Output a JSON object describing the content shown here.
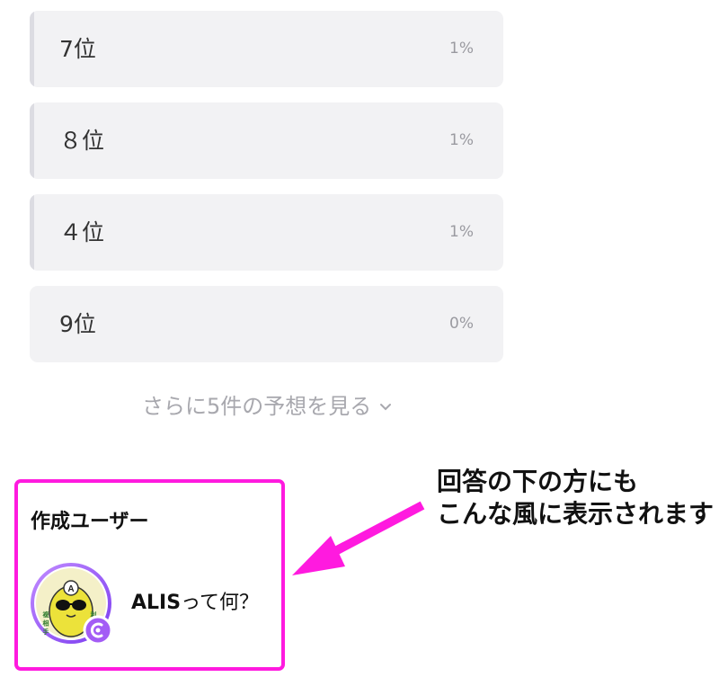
{
  "poll": {
    "options": [
      {
        "label": "7位",
        "percent_text": "1%",
        "percent": 1
      },
      {
        "label": "８位",
        "percent_text": "1%",
        "percent": 1
      },
      {
        "label": "４位",
        "percent_text": "1%",
        "percent": 1
      },
      {
        "label": "9位",
        "percent_text": "0%",
        "percent": 0
      }
    ],
    "show_more_label": "さらに5件の予想を見る"
  },
  "creator": {
    "section_title": "作成ユーザー",
    "name_latin": "ALIS",
    "name_rest": "って何？",
    "avatar_text": {
      "badge": "A",
      "left_column": "複 相 手",
      "right_column": "利 確"
    }
  },
  "annotation": {
    "line1": "回答の下の方にも",
    "line2": "こんな風に表示されます"
  },
  "colors": {
    "card_bg": "#f2f2f4",
    "highlight": "#ff1adf",
    "avatar_ring": "#9b5cf5",
    "avatar_bg": "#e9e03a"
  }
}
